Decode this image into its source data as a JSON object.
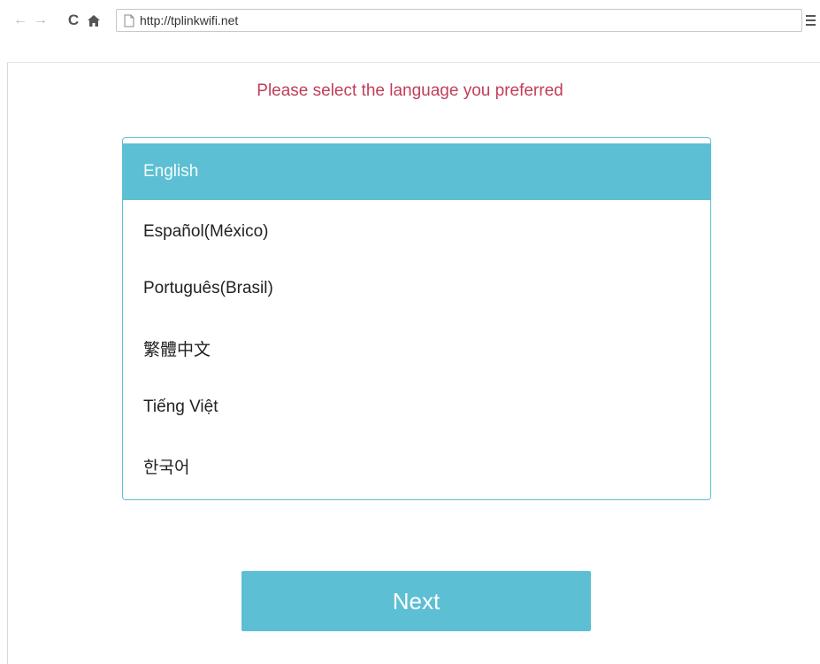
{
  "browser": {
    "url": "http://tplinkwifi.net",
    "icons": {
      "back": "arrow-left-icon",
      "forward": "arrow-right-icon",
      "reload": "reload-icon",
      "home": "home-icon",
      "page": "page-icon",
      "menu": "hamburger-menu-icon"
    }
  },
  "page": {
    "heading": "Please select the language you preferred",
    "languages": [
      {
        "label": "English",
        "selected": true
      },
      {
        "label": "Español(México)",
        "selected": false
      },
      {
        "label": "Português(Brasil)",
        "selected": false
      },
      {
        "label": "繁體中文",
        "selected": false
      },
      {
        "label": "Tiếng Việt",
        "selected": false
      },
      {
        "label": "한국어",
        "selected": false
      }
    ],
    "next_label": "Next"
  },
  "colors": {
    "accent": "#5dbfd3",
    "heading": "#c03e5a",
    "list_border": "#5fc0d1"
  }
}
